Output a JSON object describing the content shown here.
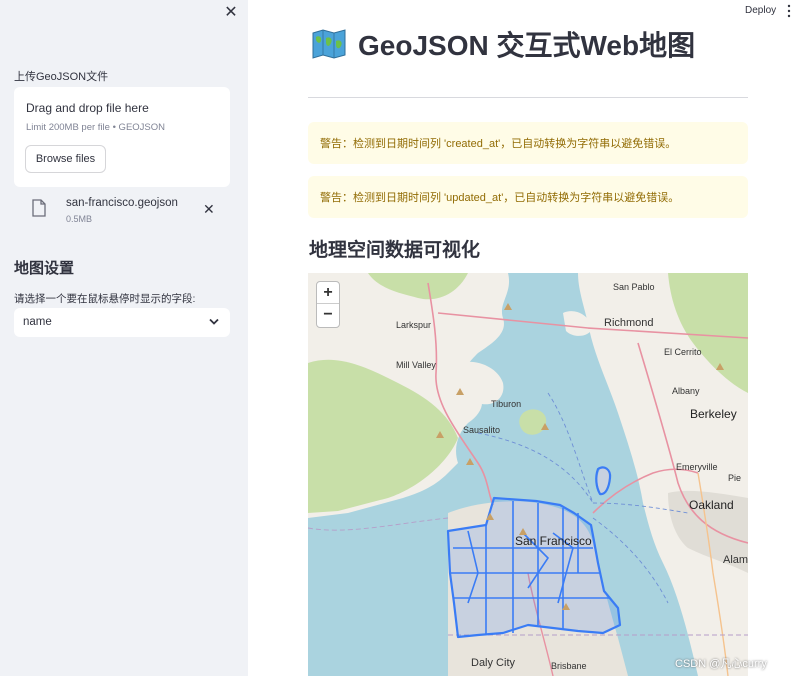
{
  "sidebar": {
    "close_icon": "close-icon",
    "upload_label": "上传GeoJSON文件",
    "dropzone_title": "Drag and drop file here",
    "dropzone_limit": "Limit 200MB per file • GEOJSON",
    "browse_label": "Browse files",
    "file": {
      "name": "san-francisco.geojson",
      "size": "0.5MB"
    },
    "map_settings_title": "地图设置",
    "select_label": "请选择一个要在鼠标悬停时显示的字段:",
    "select_value": "name"
  },
  "header": {
    "deploy_label": "Deploy"
  },
  "main": {
    "title": "GeoJSON 交互式Web地图",
    "alerts": [
      "警告：检测到日期时间列 'created_at'，已自动转换为字符串以避免错误。",
      "警告：检测到日期时间列 'updated_at'，已自动转换为字符串以避免错误。"
    ],
    "subheader": "地理空间数据可视化"
  },
  "map": {
    "zoom_in": "+",
    "zoom_out": "−",
    "labels": {
      "larkspur": "Larkspur",
      "mill_valley": "Mill Valley",
      "tiburon": "Tiburon",
      "sausalito": "Sausalito",
      "san_pablo": "San Pablo",
      "richmond": "Richmond",
      "el_cerrito": "El Cerrito",
      "albany": "Albany",
      "berkeley": "Berkeley",
      "emeryville": "Emeryville",
      "oakland": "Oakland",
      "san_francisco": "San Francisco",
      "alameda": "Alam",
      "daly_city": "Daly City",
      "brisbane": "Brisbane",
      "piedmont": "Pie"
    },
    "colors": {
      "water": "#aad3df",
      "land": "#f2efe9",
      "park": "#c8dfa8",
      "geojson": "#3a7cf5"
    }
  },
  "watermark": "CSDN @凡心curry"
}
